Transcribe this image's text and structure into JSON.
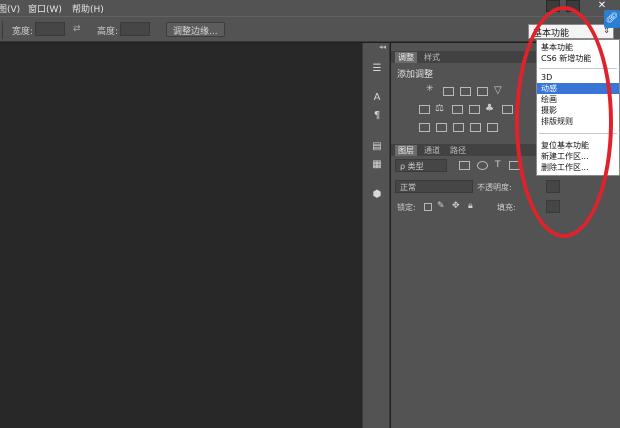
{
  "menubar": {
    "items": [
      "图(V)",
      "窗口(W)",
      "帮助(H)"
    ],
    "close_glyph": "✕"
  },
  "options": {
    "width_label": "宽度:",
    "height_label": "高度:",
    "swap_glyph": "⇄",
    "adjust_button": "调整边缘..."
  },
  "workspace": {
    "selected": "基本功能",
    "arrow": "⇕",
    "items": [
      {
        "label": "基本功能",
        "selected": false
      },
      {
        "label": "CS6 新增功能",
        "selected": false
      },
      {
        "label": "",
        "separator": true
      },
      {
        "label": "3D",
        "selected": false
      },
      {
        "label": "动感",
        "selected": true
      },
      {
        "label": "绘画",
        "selected": false
      },
      {
        "label": "摄影",
        "selected": false
      },
      {
        "label": "排版规则",
        "selected": false
      },
      {
        "label": "",
        "separator": true
      },
      {
        "label": "复位基本功能",
        "selected": false
      },
      {
        "label": "新建工作区...",
        "selected": false
      },
      {
        "label": "删除工作区...",
        "selected": false
      }
    ]
  },
  "panel_adjust": {
    "tabs": [
      "调整",
      "样式"
    ],
    "title": "添加调整"
  },
  "panel_layers": {
    "tabs": [
      "图层",
      "通道",
      "路径"
    ],
    "kind_label": "ρ 类型",
    "blend_mode": "正常",
    "opacity_label": "不透明度:",
    "lock_label": "锁定:",
    "fill_label": "填充:"
  },
  "strip": {
    "collapse_glyph": "◂◂"
  },
  "colors": {
    "annotation_oval": "#e0222b",
    "menu_selection": "#3875d7"
  }
}
